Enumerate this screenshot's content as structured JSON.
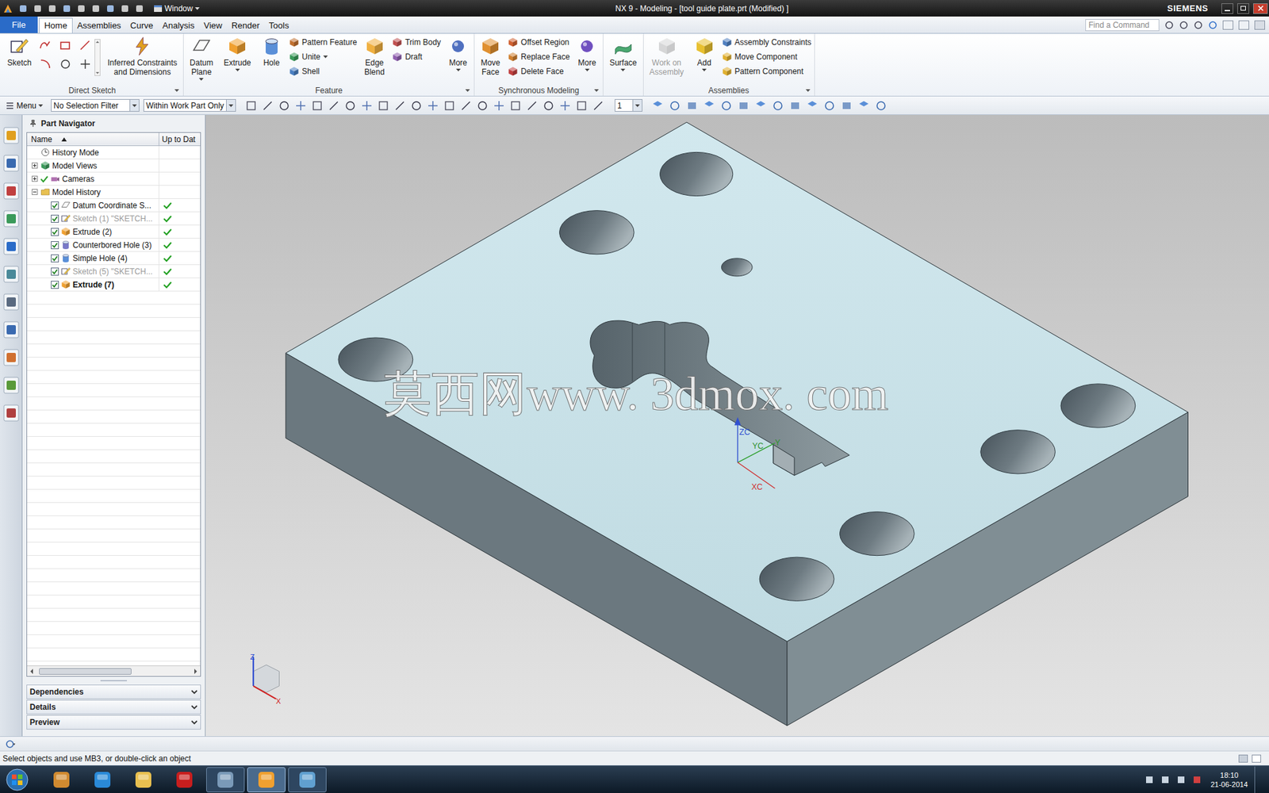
{
  "window": {
    "title": "NX 9 - Modeling - [tool guide plate.prt (Modified) ]",
    "brand": "SIEMENS",
    "quick_access": "Window",
    "search_placeholder": "Find a Command"
  },
  "tabs": [
    {
      "label": "File",
      "kind": "file",
      "selected": false
    },
    {
      "label": "Home",
      "kind": "tab",
      "selected": true
    },
    {
      "label": "Assemblies",
      "kind": "tab",
      "selected": false
    },
    {
      "label": "Curve",
      "kind": "tab",
      "selected": false
    },
    {
      "label": "Analysis",
      "kind": "tab",
      "selected": false
    },
    {
      "label": "View",
      "kind": "tab",
      "selected": false
    },
    {
      "label": "Render",
      "kind": "tab",
      "selected": false
    },
    {
      "label": "Tools",
      "kind": "tab",
      "selected": false
    }
  ],
  "ribbon": {
    "groups": [
      {
        "label": "Direct Sketch",
        "columns": [
          {
            "layout": "large",
            "buttons": [
              {
                "lines": [
                  "Sketch"
                ],
                "kind": "sketch",
                "disabled": false,
                "dropdown": false
              }
            ]
          },
          {
            "layout": "palette",
            "buttons": []
          },
          {
            "layout": "large",
            "buttons": [
              {
                "lines": [
                  "Inferred Constraints",
                  "and Dimensions"
                ],
                "kind": "constraints",
                "disabled": false,
                "dropdown": false
              }
            ]
          }
        ]
      },
      {
        "label": "Feature",
        "columns": [
          {
            "layout": "large",
            "buttons": [
              {
                "lines": [
                  "Datum",
                  "Plane"
                ],
                "kind": "datum",
                "disabled": false,
                "dropdown": true
              }
            ]
          },
          {
            "layout": "large",
            "buttons": [
              {
                "lines": [
                  "Extrude"
                ],
                "kind": "extrude",
                "disabled": false,
                "dropdown": true
              }
            ]
          },
          {
            "layout": "large",
            "buttons": [
              {
                "lines": [
                  "Hole"
                ],
                "kind": "hole",
                "disabled": false,
                "dropdown": false
              }
            ]
          },
          {
            "layout": "stack",
            "buttons": [
              {
                "lines": [
                  "Pattern Feature"
                ],
                "kind": "pattern",
                "disabled": false,
                "dropdown": false
              },
              {
                "lines": [
                  "Unite"
                ],
                "kind": "unite",
                "disabled": false,
                "dropdown": true
              },
              {
                "lines": [
                  "Shell"
                ],
                "kind": "shell",
                "disabled": false,
                "dropdown": false
              }
            ]
          },
          {
            "layout": "large",
            "buttons": [
              {
                "lines": [
                  "Edge",
                  "Blend"
                ],
                "kind": "blend",
                "disabled": false,
                "dropdown": false
              }
            ]
          },
          {
            "layout": "stack",
            "buttons": [
              {
                "lines": [
                  "Trim Body"
                ],
                "kind": "trim",
                "disabled": false,
                "dropdown": false
              },
              {
                "lines": [
                  "Draft"
                ],
                "kind": "draft",
                "disabled": false,
                "dropdown": false
              }
            ]
          },
          {
            "layout": "large",
            "buttons": [
              {
                "lines": [
                  "More"
                ],
                "kind": "more",
                "disabled": false,
                "dropdown": true
              }
            ]
          }
        ]
      },
      {
        "label": "Synchronous Modeling",
        "columns": [
          {
            "layout": "large",
            "buttons": [
              {
                "lines": [
                  "Move",
                  "Face"
                ],
                "kind": "move",
                "disabled": false,
                "dropdown": false
              }
            ]
          },
          {
            "layout": "stack",
            "buttons": [
              {
                "lines": [
                  "Offset Region"
                ],
                "kind": "offset",
                "disabled": false,
                "dropdown": false
              },
              {
                "lines": [
                  "Replace Face"
                ],
                "kind": "replace",
                "disabled": false,
                "dropdown": false
              },
              {
                "lines": [
                  "Delete Face"
                ],
                "kind": "delete",
                "disabled": false,
                "dropdown": false
              }
            ]
          },
          {
            "layout": "large",
            "buttons": [
              {
                "lines": [
                  "More"
                ],
                "kind": "more2",
                "disabled": false,
                "dropdown": true
              }
            ]
          }
        ]
      },
      {
        "label": "",
        "columns": [
          {
            "layout": "large",
            "buttons": [
              {
                "lines": [
                  "Surface"
                ],
                "kind": "surface",
                "disabled": false,
                "dropdown": true
              }
            ]
          }
        ]
      },
      {
        "label": "Assemblies",
        "columns": [
          {
            "layout": "large",
            "buttons": [
              {
                "lines": [
                  "Work on",
                  "Assembly"
                ],
                "kind": "work",
                "disabled": true,
                "dropdown": false
              }
            ]
          },
          {
            "layout": "large",
            "buttons": [
              {
                "lines": [
                  "Add"
                ],
                "kind": "add",
                "disabled": false,
                "dropdown": true
              }
            ]
          },
          {
            "layout": "stack",
            "buttons": [
              {
                "lines": [
                  "Assembly Constraints"
                ],
                "kind": "asmconstraint",
                "disabled": false,
                "dropdown": false
              },
              {
                "lines": [
                  "Move Component"
                ],
                "kind": "movecomp",
                "disabled": false,
                "dropdown": false
              },
              {
                "lines": [
                  "Pattern Component"
                ],
                "kind": "patterncomp",
                "disabled": false,
                "dropdown": false
              }
            ]
          }
        ]
      }
    ]
  },
  "toolbar": {
    "menu": "Menu",
    "selection_filter": "No Selection Filter",
    "scope": "Within Work Part Only",
    "layer": "1"
  },
  "navigator": {
    "title": "Part Navigator",
    "columns": [
      "Name",
      "Up to Dat"
    ],
    "rows": [
      {
        "label": "History Mode",
        "kind": "history",
        "expander": "none",
        "nested": false,
        "checkbox": false,
        "checked": false,
        "tick": false,
        "greyed": false,
        "bold": false,
        "up_to_date": false
      },
      {
        "label": "Model Views",
        "kind": "views",
        "expander": "collapsed",
        "nested": false,
        "checkbox": false,
        "checked": false,
        "tick": false,
        "greyed": false,
        "bold": false,
        "up_to_date": false
      },
      {
        "label": "Cameras",
        "kind": "cameras",
        "expander": "collapsed",
        "nested": false,
        "checkbox": false,
        "checked": false,
        "tick": true,
        "greyed": false,
        "bold": false,
        "up_to_date": false
      },
      {
        "label": "Model History",
        "kind": "folder",
        "expander": "expanded",
        "nested": false,
        "checkbox": false,
        "checked": false,
        "tick": false,
        "greyed": false,
        "bold": false,
        "up_to_date": false
      },
      {
        "label": "Datum Coordinate S...",
        "kind": "datum",
        "expander": "none",
        "nested": true,
        "checkbox": true,
        "checked": true,
        "tick": false,
        "greyed": false,
        "bold": false,
        "up_to_date": true
      },
      {
        "label": "Sketch (1) \"SKETCH...",
        "kind": "sketch",
        "expander": "none",
        "nested": true,
        "checkbox": true,
        "checked": true,
        "tick": false,
        "greyed": true,
        "bold": false,
        "up_to_date": true
      },
      {
        "label": "Extrude (2)",
        "kind": "extrude",
        "expander": "none",
        "nested": true,
        "checkbox": true,
        "checked": true,
        "tick": false,
        "greyed": false,
        "bold": false,
        "up_to_date": true
      },
      {
        "label": "Counterbored Hole (3)",
        "kind": "cbhole",
        "expander": "none",
        "nested": true,
        "checkbox": true,
        "checked": true,
        "tick": false,
        "greyed": false,
        "bold": false,
        "up_to_date": true
      },
      {
        "label": "Simple Hole (4)",
        "kind": "hole",
        "expander": "none",
        "nested": true,
        "checkbox": true,
        "checked": true,
        "tick": false,
        "greyed": false,
        "bold": false,
        "up_to_date": true
      },
      {
        "label": "Sketch (5) \"SKETCH...",
        "kind": "sketch",
        "expander": "none",
        "nested": true,
        "checkbox": true,
        "checked": true,
        "tick": false,
        "greyed": true,
        "bold": false,
        "up_to_date": true
      },
      {
        "label": "Extrude (7)",
        "kind": "extrude",
        "expander": "none",
        "nested": true,
        "checkbox": true,
        "checked": true,
        "tick": false,
        "greyed": false,
        "bold": true,
        "up_to_date": true
      }
    ],
    "panels": [
      {
        "label": "Dependencies",
        "expanded": false
      },
      {
        "label": "Details",
        "expanded": false
      },
      {
        "label": "Preview",
        "expanded": false
      }
    ]
  },
  "graphics": {
    "watermark": "莫西网www. 3dmox. com",
    "wcs": {
      "zc": "ZC",
      "yc": "YC",
      "y": "Y",
      "xc": "XC"
    },
    "view_triad": {
      "z": "Z",
      "x": "X"
    }
  },
  "status": {
    "message": "Select objects and use MB3, or double-click an object"
  },
  "taskbar": {
    "buttons": [
      {
        "kind": "explorer",
        "running": false,
        "active": false
      },
      {
        "kind": "ie",
        "running": false,
        "active": false
      },
      {
        "kind": "folder",
        "running": false,
        "active": false
      },
      {
        "kind": "acrobat",
        "running": false,
        "active": false
      },
      {
        "kind": "calculator",
        "running": true,
        "active": false
      },
      {
        "kind": "nx",
        "running": true,
        "active": true
      },
      {
        "kind": "paint",
        "running": true,
        "active": false
      }
    ],
    "time": "18:10",
    "date": "21-06-2014"
  }
}
